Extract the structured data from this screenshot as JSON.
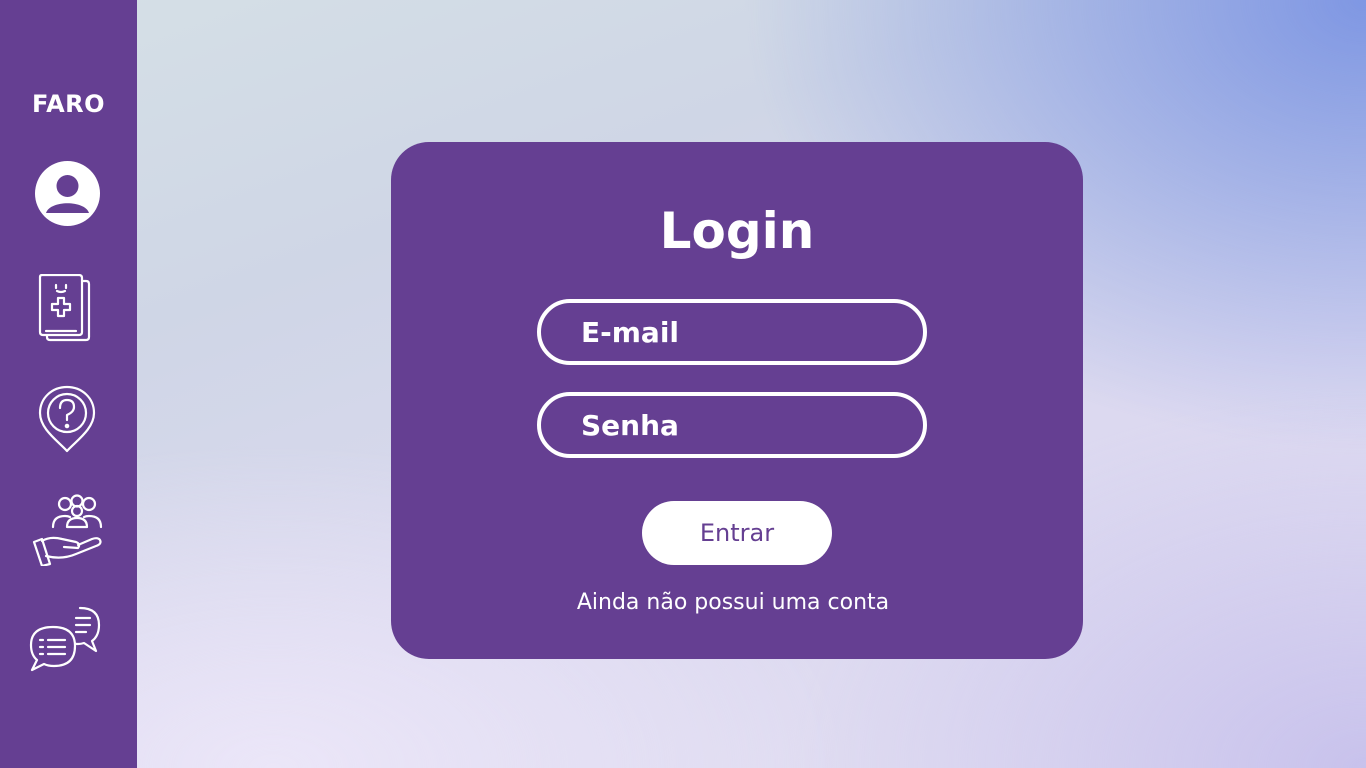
{
  "sidebar": {
    "brand": "FARO",
    "items": [
      {
        "icon": "user-profile-icon"
      },
      {
        "icon": "medical-record-icon"
      },
      {
        "icon": "help-location-icon"
      },
      {
        "icon": "community-care-icon"
      },
      {
        "icon": "chat-icon"
      }
    ]
  },
  "login": {
    "title": "Login",
    "email_placeholder": "E-mail",
    "password_placeholder": "Senha",
    "submit_label": "Entrar",
    "signup_link": "Ainda não possui uma conta"
  },
  "colors": {
    "primary": "#653f92",
    "text_on_primary": "#ffffff"
  }
}
